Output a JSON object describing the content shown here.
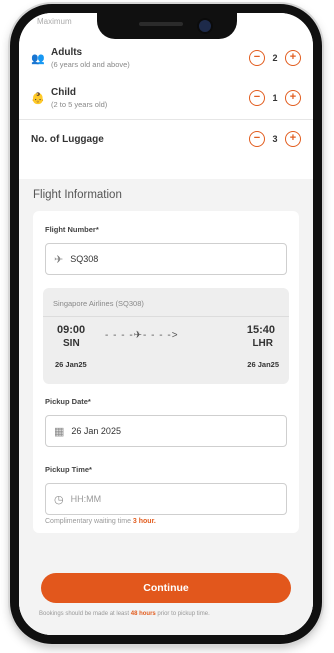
{
  "passengers": {
    "top_cutoff_label": "Maximum",
    "adults": {
      "label": "Adults",
      "sub": "(6 years old and above)",
      "count": "2"
    },
    "child": {
      "label": "Child",
      "sub": "(2 to 5 years old)",
      "count": "1"
    },
    "luggage": {
      "label": "No. of Luggage",
      "count": "3"
    }
  },
  "flight_info": {
    "title": "Flight Information",
    "flight_number_label": "Flight Number*",
    "flight_number_value": "SQ308",
    "airline_line": "Singapore Airlines (SQ308)",
    "depart_time": "09:00",
    "depart_code": "SIN",
    "depart_date": "26 Jan25",
    "arrive_time": "15:40",
    "arrive_code": "LHR",
    "arrive_date": "26 Jan25",
    "route_glyph": "- - - -✈- - - ->",
    "pickup_date_label": "Pickup Date*",
    "pickup_date_value": "26 Jan 2025",
    "pickup_time_label": "Pickup Time*",
    "pickup_time_placeholder": "HH:MM",
    "waiting_note_prefix": "Complimentary waiting time ",
    "waiting_note_bold": "3 hour."
  },
  "actions": {
    "continue_label": "Continue",
    "footer_prefix": "Bookings should be made at least ",
    "footer_bold": "48 hours",
    "footer_suffix": " prior to pickup time."
  },
  "icons": {
    "adult": "people-icon",
    "child": "child-icon",
    "minus": "minus-circle-icon",
    "plus": "plus-circle-icon",
    "plane": "plane-icon",
    "calendar": "calendar-icon",
    "clock": "clock-icon"
  },
  "colors": {
    "accent": "#e2571c"
  }
}
